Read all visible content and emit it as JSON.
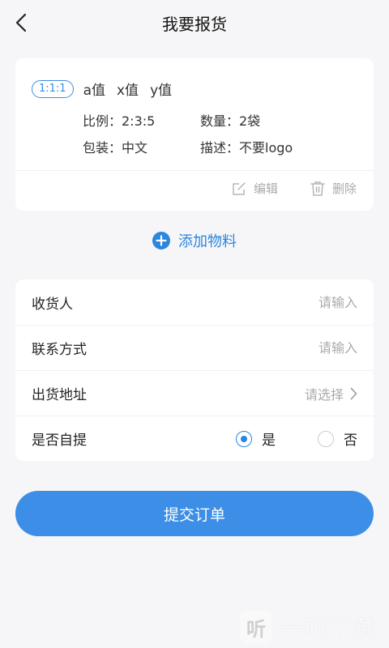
{
  "header": {
    "title": "我要报货"
  },
  "material": {
    "ratio_tag": "1:1:1",
    "values": [
      "a值",
      "x值",
      "y值"
    ],
    "ratio": "比例：2:3:5",
    "quantity": "数量：2袋",
    "packaging": "包装：中文",
    "description": "描述：不要logo",
    "edit_label": "编辑",
    "delete_label": "删除"
  },
  "add_material_label": "添加物料",
  "form": {
    "receiver_label": "收货人",
    "receiver_placeholder": "请输入",
    "contact_label": "联系方式",
    "contact_placeholder": "请输入",
    "address_label": "出货地址",
    "address_placeholder": "请选择",
    "self_pickup_label": "是否自提",
    "self_pickup_yes": "是",
    "self_pickup_no": "否",
    "self_pickup_selected": "是"
  },
  "submit_label": "提交订单",
  "watermark": {
    "text": "一听下载",
    "logo_glyph": "听"
  },
  "colors": {
    "accent": "#3c8ee6",
    "background": "#f6f6f8"
  }
}
